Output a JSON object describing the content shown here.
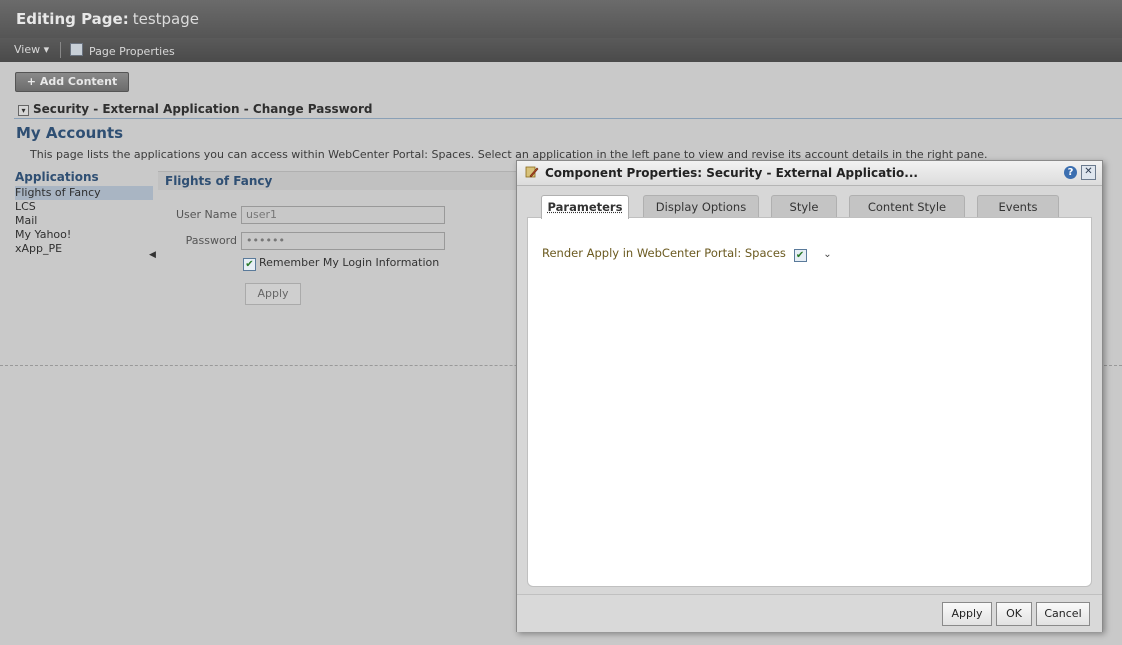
{
  "header": {
    "title_prefix": "Editing Page:",
    "page_name": "testpage"
  },
  "toolbar": {
    "view_label": "View ▾",
    "page_properties_label": "Page Properties"
  },
  "add_content_label": "+ Add Content",
  "section": {
    "title": "Security - External Application - Change Password"
  },
  "accounts": {
    "title": "My Accounts",
    "description": "This page lists the applications you can access within WebCenter Portal: Spaces. Select an application in the left pane to view and revise its account details in the right pane.",
    "apps_heading": "Applications",
    "apps": [
      {
        "label": "Flights of Fancy",
        "selected": true
      },
      {
        "label": "LCS"
      },
      {
        "label": "Mail"
      },
      {
        "label": "My Yahoo!"
      },
      {
        "label": "xApp_PE"
      }
    ],
    "detail_title": "Flights of Fancy",
    "user_name_label": "User Name",
    "user_name_value": "user1",
    "password_label": "Password",
    "password_value": "••••••",
    "remember_label": "Remember My Login Information",
    "apply_label": "Apply"
  },
  "dialog": {
    "title": "Component Properties: Security - External Applicatio...",
    "tabs": [
      "Parameters",
      "Display Options",
      "Style",
      "Content Style",
      "Events"
    ],
    "active_tab": "Parameters",
    "render_label": "Render Apply in WebCenter Portal: Spaces",
    "buttons": {
      "apply": "Apply",
      "ok": "OK",
      "cancel": "Cancel"
    }
  },
  "colors": {
    "topbar": "#5f5f5f",
    "accent_blue": "#2f4f73",
    "selection": "#a9b5c3"
  }
}
